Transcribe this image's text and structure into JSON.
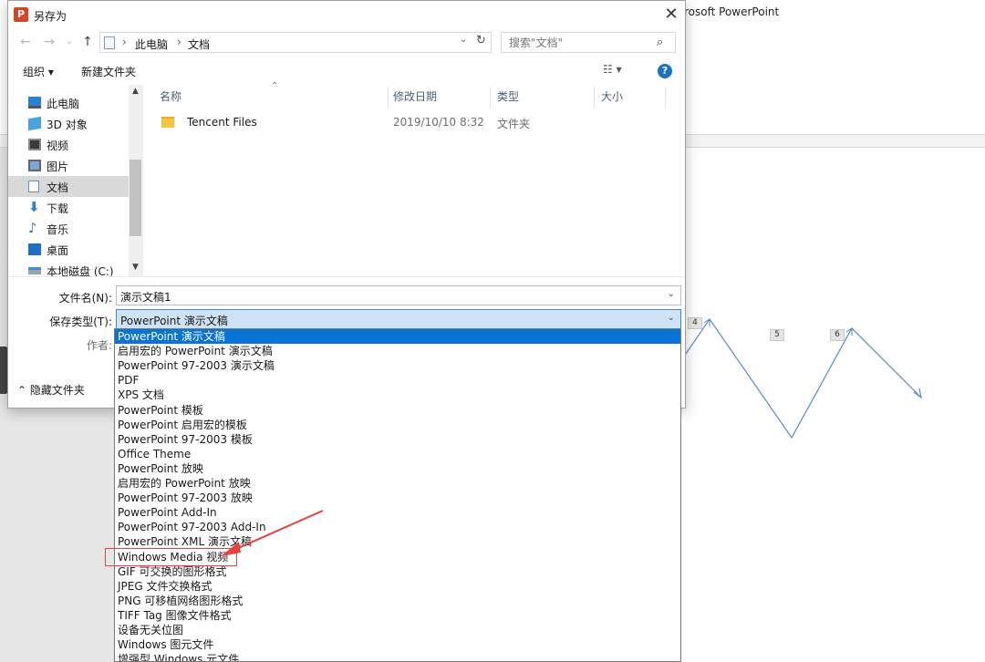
{
  "background": {
    "app_title": "rosoft PowerPoint",
    "step_tags": [
      "4",
      "5",
      "6"
    ]
  },
  "dialog": {
    "app_icon_letter": "P",
    "title": "另存为",
    "close_glyph": "✕",
    "nav": {
      "back_glyph": "←",
      "forward_glyph": "→",
      "recent_glyph": "⌄",
      "up_glyph": "↑",
      "breadcrumb": [
        "此电脑",
        "文档"
      ],
      "separator": "›",
      "refresh_glyph": "↻",
      "search_placeholder": "搜索\"文档\"",
      "search_glyph": "⌕"
    },
    "toolbar": {
      "organize_label": "组织 ▾",
      "new_folder_label": "新建文件夹",
      "view_label": "☷ ▾",
      "help_label": "?"
    },
    "sidebar": {
      "items": [
        {
          "label": "此电脑",
          "icon": "computer-icon"
        },
        {
          "label": "3D 对象",
          "icon": "cube-icon"
        },
        {
          "label": "视频",
          "icon": "video-icon"
        },
        {
          "label": "图片",
          "icon": "picture-icon"
        },
        {
          "label": "文档",
          "icon": "document-icon",
          "selected": true
        },
        {
          "label": "下载",
          "icon": "download-icon"
        },
        {
          "label": "音乐",
          "icon": "music-icon"
        },
        {
          "label": "桌面",
          "icon": "desktop-icon"
        },
        {
          "label": "本地磁盘 (C:)",
          "icon": "disk-icon"
        }
      ]
    },
    "file_list": {
      "columns": [
        "名称",
        "修改日期",
        "类型",
        "大小"
      ],
      "rows": [
        {
          "name": "Tencent Files",
          "modified": "2019/10/10 8:32",
          "type": "文件夹",
          "size": ""
        }
      ]
    },
    "form": {
      "filename_label": "文件名(N):",
      "filename_value": "演示文稿1",
      "savetype_label": "保存类型(T):",
      "savetype_value": "PowerPoint 演示文稿",
      "author_label": "作者:"
    },
    "hide_folders_label": "隐藏文件夹"
  },
  "save_type_options": [
    "PowerPoint 演示文稿",
    "启用宏的 PowerPoint 演示文稿",
    "PowerPoint 97-2003 演示文稿",
    "PDF",
    "XPS 文档",
    "PowerPoint 模板",
    "PowerPoint 启用宏的模板",
    "PowerPoint 97-2003 模板",
    "Office Theme",
    "PowerPoint 放映",
    "启用宏的 PowerPoint 放映",
    "PowerPoint 97-2003 放映",
    "PowerPoint Add-In",
    "PowerPoint 97-2003 Add-In",
    "PowerPoint XML 演示文稿",
    "Windows Media 视频",
    "GIF 可交换的图形格式",
    "JPEG 文件交换格式",
    "PNG 可移植网络图形格式",
    "TIFF Tag 图像文件格式",
    "设备无关位图",
    "Windows 图元文件",
    "增强型 Windows 元文件"
  ],
  "selected_option_index": 0,
  "highlighted_option": "Windows Media 视频",
  "colors": {
    "selection_blue": "#0a74d6",
    "annotation_red": "#e8413c",
    "zigzag_line": "#5b8ac4"
  }
}
